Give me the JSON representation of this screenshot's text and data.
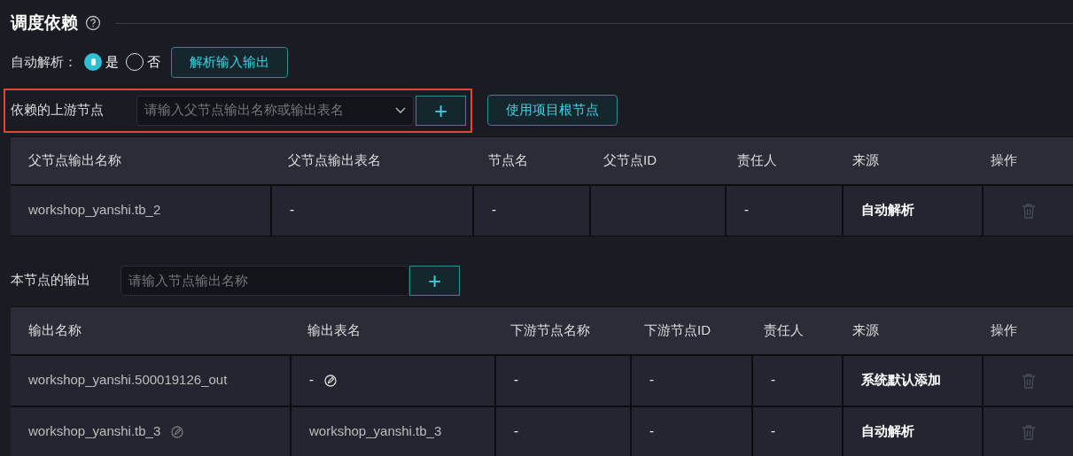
{
  "section": {
    "title": "调度依赖"
  },
  "auto_parse": {
    "label": "自动解析：",
    "options": [
      {
        "label": "是",
        "selected": true
      },
      {
        "label": "否",
        "selected": false
      }
    ],
    "button": "解析输入输出"
  },
  "upstream": {
    "label": "依赖的上游节点",
    "placeholder": "请输入父节点输出名称或输出表名",
    "add_button": "+",
    "root_button": "使用项目根节点",
    "highlighted": true,
    "table": {
      "columns": [
        "父节点输出名称",
        "父节点输出表名",
        "节点名",
        "父节点ID",
        "责任人",
        "来源",
        "操作"
      ],
      "rows": [
        {
          "cells": [
            {
              "text": "workshop_yanshi.tb_2",
              "blurred": true
            },
            {
              "text": "-"
            },
            {
              "text": "-"
            },
            {},
            {
              "text": "-"
            },
            {
              "text": "自动解析"
            }
          ],
          "delete_disabled": true
        }
      ]
    }
  },
  "output": {
    "label": "本节点的输出",
    "placeholder": "请输入节点输出名称",
    "add_button": "+",
    "table": {
      "columns": [
        "输出名称",
        "输出表名",
        "下游节点名称",
        "下游节点ID",
        "责任人",
        "来源",
        "操作"
      ],
      "rows": [
        {
          "cells": [
            {
              "text": "workshop_yanshi.500019126_out",
              "blurred": true
            },
            {
              "text": "-",
              "edit_icon": true
            },
            {
              "text": "-"
            },
            {
              "text": "-"
            },
            {
              "text": "-"
            },
            {
              "text": "系统默认添加"
            }
          ],
          "delete_disabled": true
        },
        {
          "cells": [
            {
              "text": "workshop_yanshi.tb_3",
              "blurred": true,
              "edit_icon": true
            },
            {
              "text": "workshop_yanshi.tb_3",
              "blurred": true
            },
            {
              "text": "-"
            },
            {
              "text": "-"
            },
            {
              "text": "-"
            },
            {
              "text": "自动解析"
            }
          ],
          "delete_disabled": true
        }
      ]
    }
  }
}
